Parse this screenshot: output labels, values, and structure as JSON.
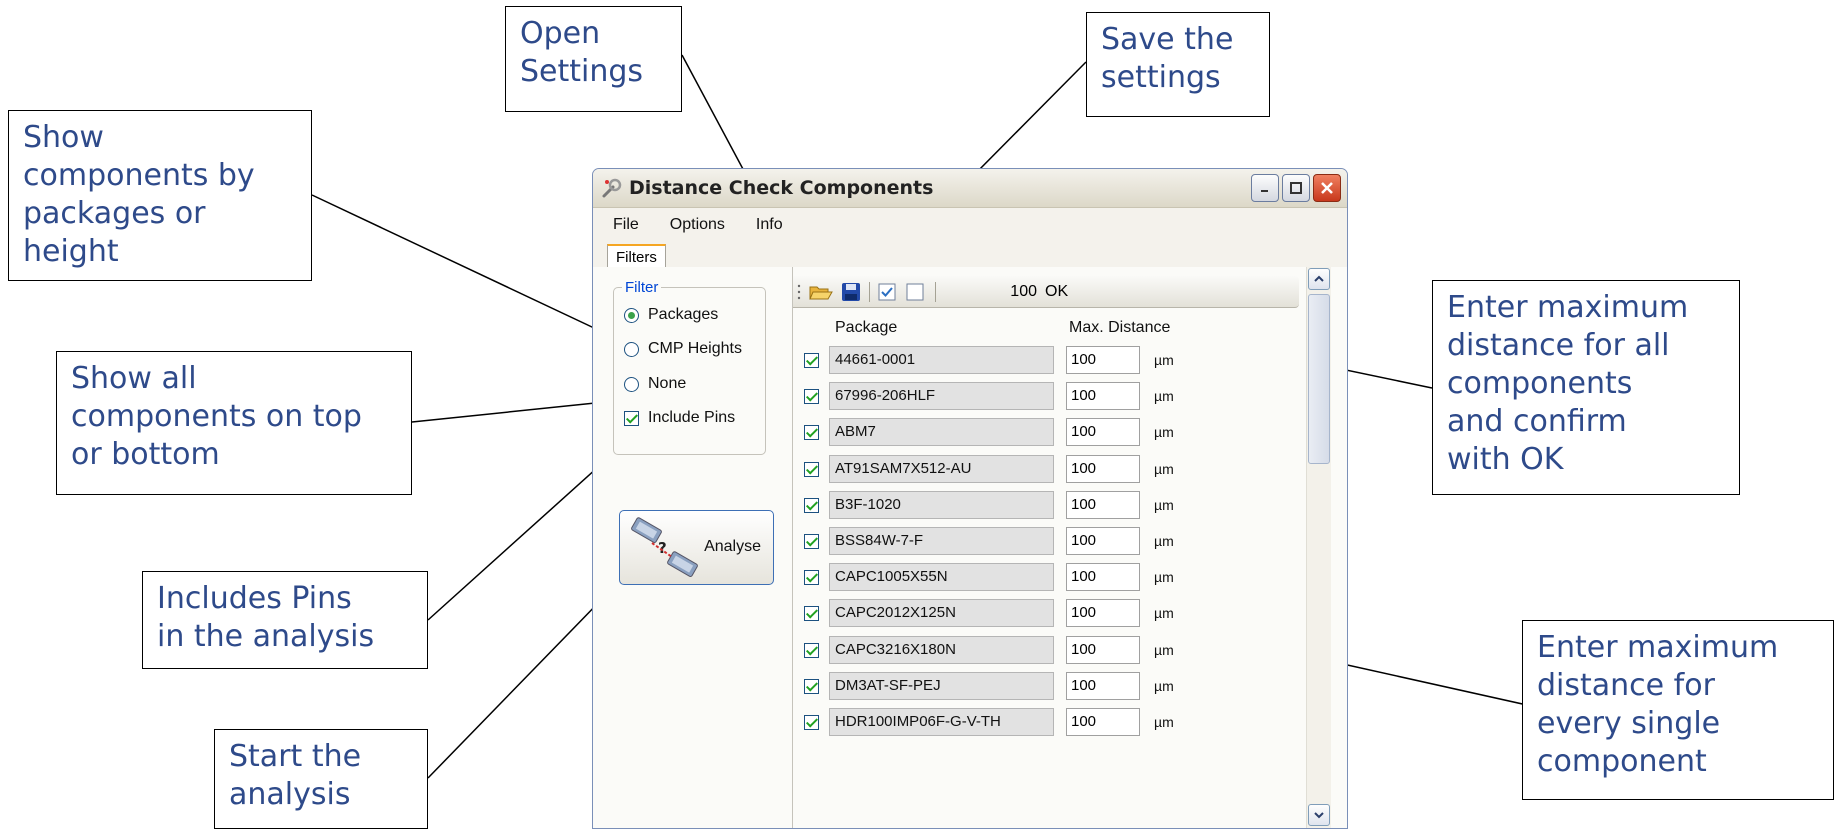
{
  "callouts": {
    "open_settings": [
      "Open",
      "Settings"
    ],
    "save_settings": [
      "Save the",
      "settings"
    ],
    "show_by_package": [
      "Show",
      "components by",
      "packages or",
      "height"
    ],
    "show_all": [
      "Show all",
      "components on top",
      "or bottom"
    ],
    "includes_pins": [
      "Includes Pins",
      "in the analysis"
    ],
    "start_analysis": [
      "Start the",
      "analysis"
    ],
    "max_all": [
      "Enter maximum",
      "distance for all",
      "components",
      "and confirm",
      "with OK"
    ],
    "max_single": [
      "Enter maximum",
      "distance for",
      "every single",
      "component"
    ]
  },
  "window": {
    "title": "Distance Check Components",
    "icon": "wrench-icon"
  },
  "menu": {
    "file": "File",
    "options": "Options",
    "info": "Info"
  },
  "tab": "Filters",
  "filter": {
    "legend": "Filter",
    "packages": "Packages",
    "cmp_heights": "CMP Heights",
    "none": "None",
    "include_pins": "Include Pins",
    "selected": "packages",
    "include_pins_checked": true
  },
  "analyse_label": "Analyse",
  "toolbar": {
    "open_icon": "folder-open-icon",
    "save_icon": "floppy-disk-icon",
    "check_all_icon": "checkbox-checked-icon",
    "uncheck_all_icon": "checkbox-empty-icon",
    "value": "100",
    "ok": "OK"
  },
  "grid": {
    "col_package": "Package",
    "col_distance": "Max. Distance",
    "unit": "µm",
    "rows": [
      {
        "package": "44661-0001",
        "distance": "100"
      },
      {
        "package": "67996-206HLF",
        "distance": "100"
      },
      {
        "package": "ABM7",
        "distance": "100"
      },
      {
        "package": "AT91SAM7X512-AU",
        "distance": "100"
      },
      {
        "package": "B3F-1020",
        "distance": "100"
      },
      {
        "package": "BSS84W-7-F",
        "distance": "100"
      },
      {
        "package": "CAPC1005X55N",
        "distance": "100"
      },
      {
        "package": "CAPC2012X125N",
        "distance": "100"
      },
      {
        "package": "CAPC3216X180N",
        "distance": "100"
      },
      {
        "package": "DM3AT-SF-PEJ",
        "distance": "100"
      },
      {
        "package": "HDR100IMP06F-G-V-TH",
        "distance": "100"
      }
    ]
  },
  "colors": {
    "callout_text": "#2e4a8a",
    "checkmark": "#21a121",
    "close_button": "#c8381c"
  }
}
